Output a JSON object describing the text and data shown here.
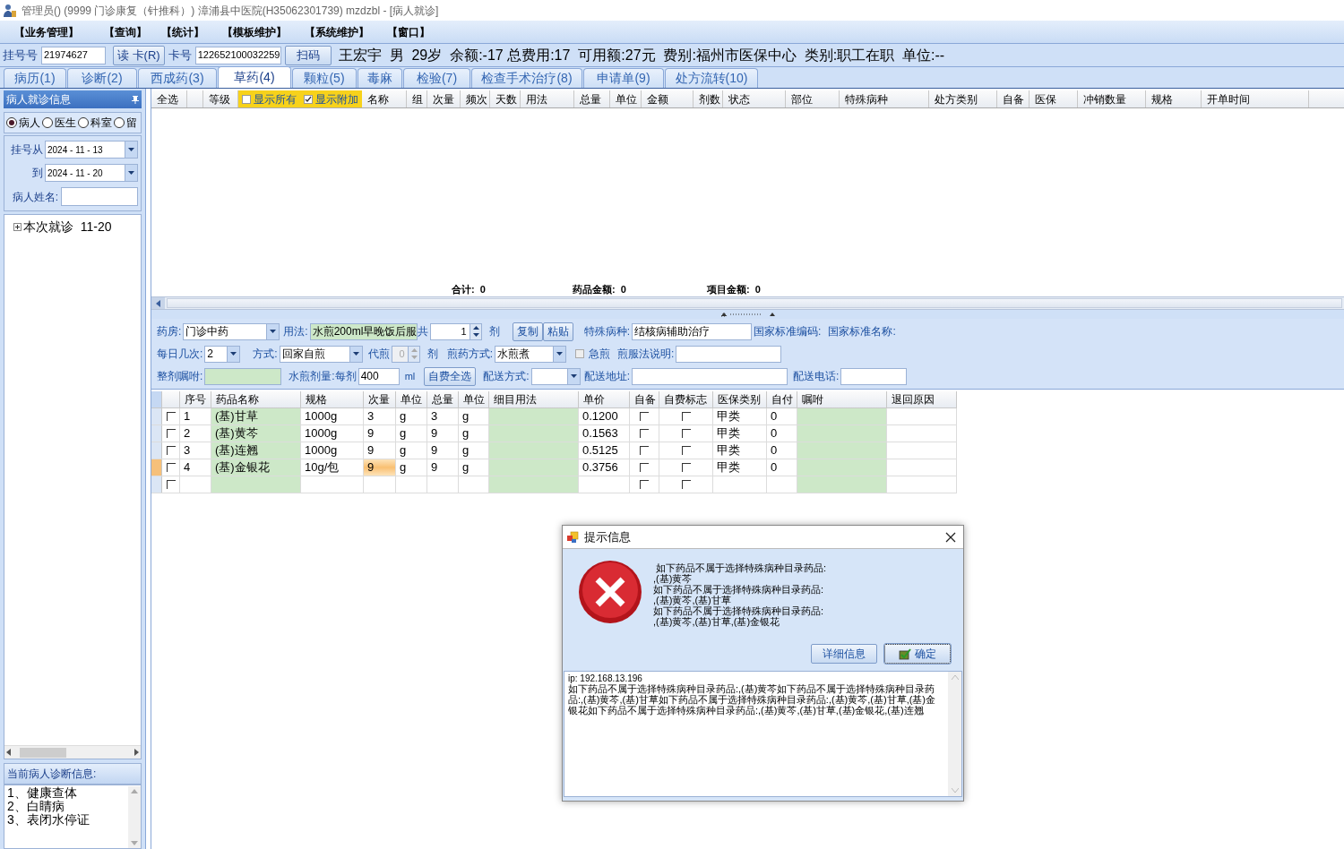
{
  "window": {
    "title": "管理员() (9999 门诊康复（针推科）) 漳浦县中医院(H35062301739) mzdzbl - [病人就诊]"
  },
  "menu": [
    "【业务管理】",
    "【查询】",
    "【统计】",
    "【模板维护】",
    "【系统维护】",
    "【窗口】"
  ],
  "patient_bar": {
    "reg_label": "挂号号",
    "reg_value": "21974627",
    "read_card": "读 卡(R)",
    "card_label": "卡号",
    "card_value": "122652100032259",
    "scan": "扫码",
    "info": "王宏宇  男  29岁  余额:-17 总费用:17  可用额:27元  费别:福州市医保中心  类别:职工在职  单位:--"
  },
  "tabs": [
    {
      "label": "病历(1)",
      "selected": false
    },
    {
      "label": "诊断(2)",
      "selected": false
    },
    {
      "label": "西成药(3)",
      "selected": false
    },
    {
      "label": "草药(4)",
      "selected": true
    },
    {
      "label": "颗粒(5)",
      "selected": false
    },
    {
      "label": "毒麻",
      "selected": false
    },
    {
      "label": "检验(7)",
      "selected": false
    },
    {
      "label": "检查手术治疗(8)",
      "selected": false
    },
    {
      "label": "申请单(9)",
      "selected": false
    },
    {
      "label": "处方流转(10)",
      "selected": false
    }
  ],
  "left_panel": {
    "title": "病人就诊信息",
    "radios": [
      {
        "label": "病人",
        "selected": true
      },
      {
        "label": "医生",
        "selected": false
      },
      {
        "label": "科室",
        "selected": false
      },
      {
        "label": "留",
        "selected": false
      }
    ],
    "date_from": {
      "label": "挂号从",
      "value": "2024 - 11 - 13"
    },
    "date_to": {
      "label": "到",
      "value": "2024 - 11 - 20"
    },
    "name": {
      "label": "病人姓名:"
    },
    "tree": [
      {
        "label": "本次就诊  11-20",
        "expanded": false
      }
    ],
    "diagnosis_title": "当前病人诊断信息:",
    "diagnoses": [
      "1、健康查体",
      "2、白睛病",
      "3、表闭水停证"
    ]
  },
  "top_grid": {
    "columns": [
      {
        "label": "全选",
        "kind": "text"
      },
      {
        "kind": "text"
      },
      {
        "label": "等级",
        "kind": "text"
      },
      {
        "label": "显示所有",
        "kind": "checkbox",
        "checked": false
      },
      {
        "label": "显示附加",
        "kind": "checkbox",
        "checked": true
      },
      {
        "label": "名称",
        "kind": "text"
      },
      {
        "label": "组",
        "kind": "text"
      },
      {
        "label": "次量",
        "kind": "text"
      },
      {
        "label": "频次",
        "kind": "text"
      },
      {
        "label": "天数",
        "kind": "text"
      },
      {
        "label": "用法",
        "kind": "text"
      },
      {
        "label": "总量",
        "kind": "text"
      },
      {
        "label": "单位",
        "kind": "text"
      },
      {
        "label": "金额",
        "kind": "text"
      },
      {
        "label": "剂数",
        "kind": "text"
      },
      {
        "label": "状态",
        "kind": "text"
      },
      {
        "label": "部位",
        "kind": "text"
      },
      {
        "label": "特殊病种",
        "kind": "text"
      },
      {
        "label": "处方类别",
        "kind": "text"
      },
      {
        "label": "自备",
        "kind": "text"
      },
      {
        "label": "医保",
        "kind": "text"
      },
      {
        "label": "冲销数量",
        "kind": "text"
      },
      {
        "label": "规格",
        "kind": "text"
      },
      {
        "label": "开单时间",
        "kind": "text"
      }
    ],
    "totals": [
      {
        "label": "合计:",
        "value": "0"
      },
      {
        "label": "药品金额:",
        "value": "0"
      },
      {
        "label": "项目金额:",
        "value": "0"
      }
    ]
  },
  "form": {
    "lines": [
      [
        {
          "kind": "select",
          "label": "药房:",
          "value": "门诊中药"
        },
        {
          "kind": "input",
          "label": "用法:",
          "value": "水煎200ml早晚饭后服",
          "highlighted": true
        },
        {
          "kind": "spin",
          "label": "共",
          "value": "1",
          "unit": "剂",
          "disabled": false
        },
        {
          "kind": "button",
          "label": "复制"
        },
        {
          "kind": "button",
          "label": "粘贴"
        },
        {
          "kind": "input",
          "label": "特殊病种:",
          "value": "结核病辅助治疗",
          "highlighted": false
        },
        {
          "kind": "label",
          "label": "国家标准编码:"
        },
        {
          "kind": "label",
          "label": "国家标准名称:"
        }
      ],
      [
        {
          "kind": "select",
          "label": "每日几次:",
          "value": "2"
        },
        {
          "kind": "select",
          "label": "方式:",
          "value": "回家自煎"
        },
        {
          "kind": "spin",
          "label": "代煎",
          "value": "0",
          "unit": "剂",
          "disabled": true
        },
        {
          "kind": "select",
          "label": "煎药方式:",
          "value": "水煎煮"
        },
        {
          "kind": "checkbox",
          "label": "急煎",
          "checked": false
        },
        {
          "kind": "input",
          "label": "煎服法说明:",
          "highlighted": false
        }
      ],
      [
        {
          "kind": "input",
          "label": "整剂嘱咐:",
          "highlighted": true
        },
        {
          "kind": "label",
          "label": "水煎剂量:"
        },
        {
          "kind": "input",
          "label": "每剂",
          "value": "400",
          "unit": "ml",
          "highlighted": false
        },
        {
          "kind": "button",
          "label": "自费全选"
        },
        {
          "kind": "select",
          "label": "配送方式:"
        },
        {
          "kind": "input",
          "label": "配送地址:",
          "highlighted": false
        },
        {
          "kind": "input",
          "label": "配送电话:",
          "highlighted": false
        }
      ]
    ]
  },
  "drug_grid": {
    "columns": [
      {
        "label": "序号",
        "kind": "text"
      },
      {
        "label": "药品名称",
        "kind": "text"
      },
      {
        "label": "规格",
        "kind": "text"
      },
      {
        "label": "次量",
        "kind": "text"
      },
      {
        "label": "单位",
        "kind": "text"
      },
      {
        "label": "总量",
        "kind": "text"
      },
      {
        "label": "单位",
        "kind": "text"
      },
      {
        "label": "细目用法",
        "kind": "text"
      },
      {
        "label": "单价",
        "kind": "text"
      },
      {
        "label": "自备",
        "kind": "check"
      },
      {
        "label": "自费标志",
        "kind": "check"
      },
      {
        "label": "医保类别",
        "kind": "text"
      },
      {
        "label": "自付",
        "kind": "text"
      },
      {
        "label": "嘱咐",
        "kind": "text"
      },
      {
        "label": "退回原因",
        "kind": "text"
      }
    ],
    "rows": [
      {
        "checked": false,
        "current": false,
        "cells": [
          "1",
          "(基)甘草",
          "1000g",
          "3",
          "g",
          "3",
          "g",
          null,
          "0.1200",
          false,
          false,
          "甲类",
          "0",
          null,
          null
        ]
      },
      {
        "checked": false,
        "current": false,
        "cells": [
          "2",
          "(基)黄芩",
          "1000g",
          "9",
          "g",
          "9",
          "g",
          null,
          "0.1563",
          false,
          false,
          "甲类",
          "0",
          null,
          null
        ]
      },
      {
        "checked": false,
        "current": false,
        "cells": [
          "3",
          "(基)连翘",
          "1000g",
          "9",
          "g",
          "9",
          "g",
          null,
          "0.5125",
          false,
          false,
          "甲类",
          "0",
          null,
          null
        ]
      },
      {
        "checked": false,
        "current": true,
        "cells": [
          "4",
          "(基)金银花",
          "10g/包",
          "9",
          "g",
          "9",
          "g",
          null,
          "0.3756",
          false,
          false,
          "甲类",
          "0",
          null,
          null
        ]
      },
      {
        "checked": false,
        "current": false,
        "cells": [
          null,
          null,
          null,
          null,
          null,
          null,
          null,
          null,
          null,
          false,
          false,
          null,
          null,
          null,
          null
        ]
      }
    ]
  },
  "dialog": {
    "title": "提示信息",
    "message_lines": [
      " 如下药品不属于选择特殊病种目录药品:",
      ",(基)黄芩",
      "如下药品不属于选择特殊病种目录药品:",
      ",(基)黄芩,(基)甘草",
      "如下药品不属于选择特殊病种目录药品:",
      ",(基)黄芩,(基)甘草,(基)金银花"
    ],
    "buttons": [
      {
        "label": "详细信息",
        "default": false
      },
      {
        "label": "确定",
        "default": true
      }
    ],
    "detail_ip": "ip: 192.168.13.196",
    "detail_text": " 如下药品不属于选择特殊病种目录药品:,(基)黄芩如下药品不属于选择特殊病种目录药品:,(基)黄芩,(基)甘草如下药品不属于选择特殊病种目录药品:,(基)黄芩,(基)甘草,(基)金银花如下药品不属于选择特殊病种目录药品:,(基)黄芩,(基)甘草,(基)金银花,(基)连翘"
  }
}
